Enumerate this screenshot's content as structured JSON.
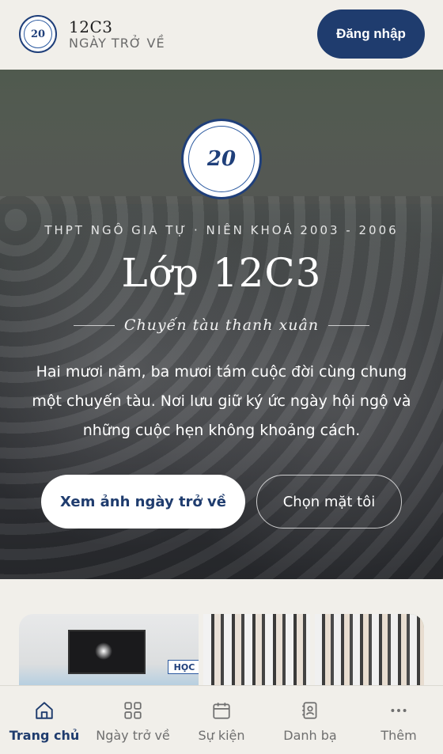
{
  "header": {
    "logo_text": "20",
    "brand_title": "12C3",
    "brand_subtitle": "NGÀY TRỞ VỀ",
    "login_label": "Đăng nhập"
  },
  "hero": {
    "badge_number": "20",
    "school": "THPT NGÔ GIA TỰ · NIÊN KHOÁ 2003 - 2006",
    "title": "Lớp 12C3",
    "tagline": "Chuyến tàu thanh xuân",
    "description_lines": [
      "Hai mươi năm, ba mươi tám cuộc đời cùng chung",
      "một chuyến tàu. Nơi lưu giữ ký ức ngày hội ngộ và",
      "những cuộc hẹn không khoảng cách."
    ],
    "primary_button": "Xem ảnh ngày trở về",
    "secondary_button": "Chọn mặt tôi"
  },
  "gallery": {
    "sign_text": "HỌC"
  },
  "nav": {
    "items": [
      {
        "label": "Trang chủ",
        "icon": "home-icon",
        "active": true
      },
      {
        "label": "Ngày trở về",
        "icon": "grid-icon",
        "active": false
      },
      {
        "label": "Sự kiện",
        "icon": "calendar-icon",
        "active": false
      },
      {
        "label": "Danh bạ",
        "icon": "contacts-icon",
        "active": false
      },
      {
        "label": "Thêm",
        "icon": "more-icon",
        "active": false
      }
    ]
  },
  "colors": {
    "primary": "#1f3c6e",
    "background": "#f1efea"
  }
}
